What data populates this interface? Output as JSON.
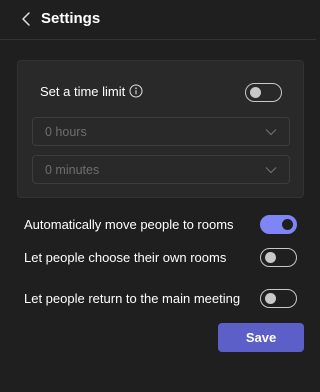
{
  "header": {
    "title": "Settings",
    "back_icon": "chevron-left-icon"
  },
  "time_limit": {
    "label": "Set a time limit",
    "info_icon": "info-icon",
    "enabled": false,
    "hours": {
      "value": "0 hours",
      "icon": "chevron-down-icon"
    },
    "minutes": {
      "value": "0 minutes",
      "icon": "chevron-down-icon"
    }
  },
  "options": [
    {
      "label": "Automatically move people to rooms",
      "enabled": true
    },
    {
      "label": "Let people choose their own rooms",
      "enabled": false
    },
    {
      "label": "Let people return to the main meeting",
      "enabled": false
    }
  ],
  "actions": {
    "save_label": "Save"
  },
  "colors": {
    "background": "#1f1f1f",
    "card": "#292929",
    "accent": "#7f85f5",
    "button": "#5b5fc7"
  }
}
